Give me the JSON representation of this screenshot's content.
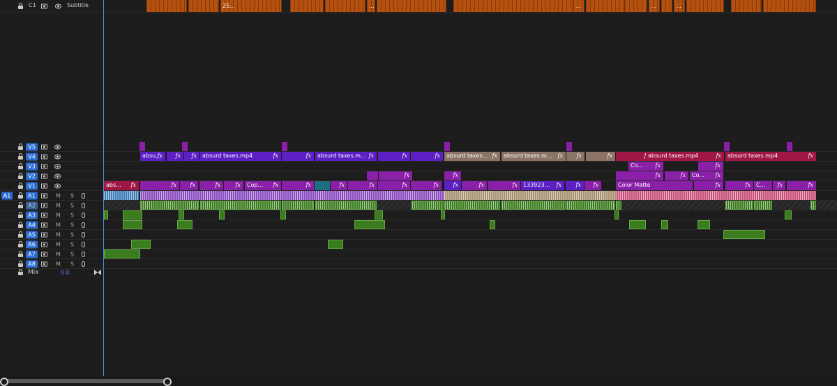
{
  "subtitle_track": {
    "label": "C1",
    "name": "Subtitle"
  },
  "video_tracks": [
    "V5",
    "V4",
    "V3",
    "V2",
    "V1"
  ],
  "audio_tracks": [
    "A1",
    "A2",
    "A3",
    "A4",
    "A5",
    "A6",
    "A7",
    "A8"
  ],
  "source_patch": "A1",
  "mute_label": "M",
  "solo_label": "S",
  "mix": {
    "label": "Mix",
    "value": "0.0"
  },
  "fx": "fx",
  "clip_texts": {
    "subtitle_25": "25...",
    "dots": "...",
    "absu": "absu...",
    "absurd_mp4": "absurd taxes.mp4",
    "absurd_m": "absurd taxes.m...",
    "absurd_dots": "absurd taxes...",
    "abs": "abs...",
    "cop": "Cop...",
    "num": "133923...",
    "color_matte": "Color Matte",
    "co": "Co...",
    "c": "C..."
  },
  "colors": {
    "accent_blue": "#2b6cd2",
    "clip_purple": "#8a1fa8",
    "clip_violet": "#5b1fc4",
    "clip_crimson": "#a01745",
    "clip_green": "#3b7d1e",
    "subtitle_orange": "#b5500f"
  }
}
